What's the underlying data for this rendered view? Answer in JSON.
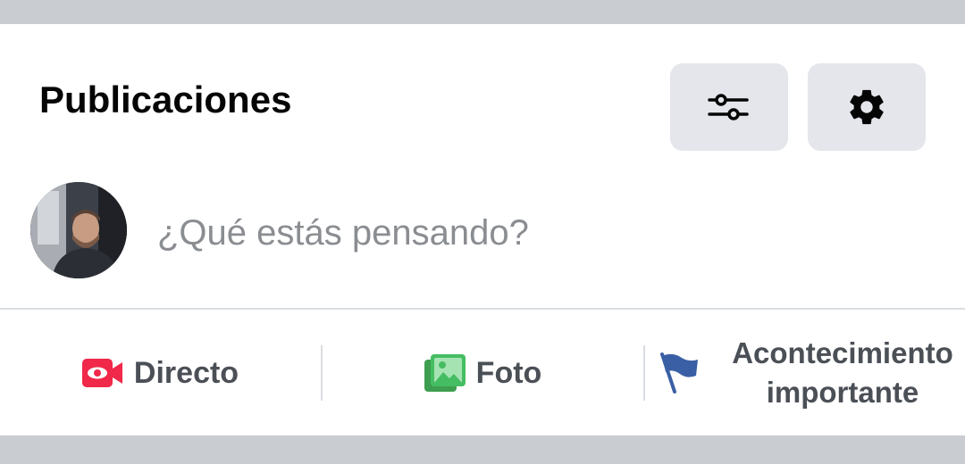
{
  "section": {
    "title": "Publicaciones",
    "filter_icon": "sliders-icon",
    "settings_icon": "gear-icon"
  },
  "composer": {
    "placeholder": "¿Qué estás pensando?"
  },
  "actions": [
    {
      "label": "Directo",
      "icon": "live-video-icon",
      "color": "#f02849"
    },
    {
      "label": "Foto",
      "icon": "photo-icon",
      "color": "#45bd62"
    },
    {
      "label_line1": "Acontecimiento",
      "label_line2": "importante",
      "icon": "flag-icon",
      "color": "#3b5fa5"
    }
  ],
  "colors": {
    "background": "#c9ccd1",
    "card": "#ffffff",
    "button_bg": "#e4e6eb",
    "placeholder": "#8a8d91",
    "label": "#4b4f56"
  }
}
